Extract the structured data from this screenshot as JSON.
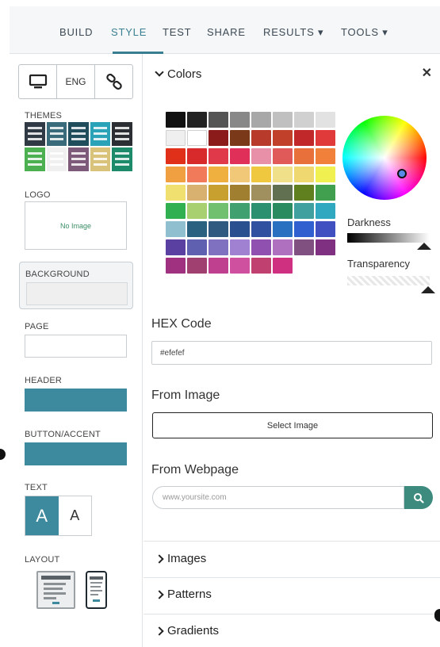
{
  "nav": {
    "tabs": [
      "BUILD",
      "STYLE",
      "TEST",
      "SHARE",
      "RESULTS ▾",
      "TOOLS ▾"
    ],
    "active": "STYLE",
    "accent": "#3a7f91"
  },
  "sidebar": {
    "device": {
      "lang_label": "ENG",
      "desktop_icon": "monitor-icon",
      "link_icon": "link-icon"
    },
    "themes_label": "THEMES",
    "theme_colors": [
      "#2f3a44",
      "#3a6b7a",
      "#1f4d5c",
      "#2aa3b8",
      "#2b2f33",
      "#4caf50",
      "#f0f0f0",
      "#7d5a7a",
      "#d9c27a",
      "#1d8a6a"
    ],
    "logo_label": "LOGO",
    "logo_placeholder": "No Image",
    "background_label": "BACKGROUND",
    "background_color": "#efefef",
    "page_label": "PAGE",
    "page_color": "#ffffff",
    "header_label": "HEADER",
    "header_color": "#3d8a9e",
    "button_accent_label": "BUTTON/ACCENT",
    "button_accent_color": "#3d8a9e",
    "text_label": "TEXT",
    "text_option_dark": "A",
    "text_option_light": "A",
    "layout_label": "LAYOUT"
  },
  "colors_panel": {
    "title": "Colors",
    "close_icon": "close-icon",
    "palette": [
      "#111111",
      "#222222",
      "#555555",
      "#888888",
      "#a8a8a8",
      "#c0c0c0",
      "#d0d0d0",
      "#e2e2e2",
      "#efefef",
      "#ffffff",
      "#8b1a1a",
      "#7a3a1a",
      "#b83a2a",
      "#c0402a",
      "#c0282a",
      "#e03a3a",
      "#e0301a",
      "#d82a2a",
      "#e03a4a",
      "#e0305a",
      "#e890a8",
      "#e05a5a",
      "#e8703a",
      "#f0803a",
      "#f0a040",
      "#f07a5a",
      "#f0b040",
      "#f0c878",
      "#f0c840",
      "#f0e08a",
      "#f0d870",
      "#f0f050",
      "#f0e070",
      "#d8b070",
      "#c8a030",
      "#a08030",
      "#a09060",
      "#607050",
      "#608020",
      "#40a050",
      "#30b050",
      "#a8d070",
      "#70c070",
      "#40a070",
      "#2a9070",
      "#2a8a60",
      "#40a0a0",
      "#30a8c0",
      "#90c0d0",
      "#2a6080",
      "#305a80",
      "#2a5090",
      "#3050a0",
      "#2a70c0",
      "#3060d0",
      "#4050c0",
      "#5a40a0",
      "#6060b0",
      "#8070c0",
      "#a080d0",
      "#9050b0",
      "#b070c0",
      "#805080",
      "#803080",
      "#a03080",
      "#a04070",
      "#c04090",
      "#d050a0",
      "#c04070",
      "#d03080"
    ],
    "darkness_label": "Darkness",
    "transparency_label": "Transparency",
    "hex_label": "HEX Code",
    "hex_value": "#efefef",
    "from_image_label": "From Image",
    "select_image_label": "Select Image",
    "from_webpage_label": "From Webpage",
    "webpage_placeholder": "www.yoursite.com",
    "search_icon": "search-icon"
  },
  "sections": {
    "images": "Images",
    "patterns": "Patterns",
    "gradients": "Gradients"
  }
}
